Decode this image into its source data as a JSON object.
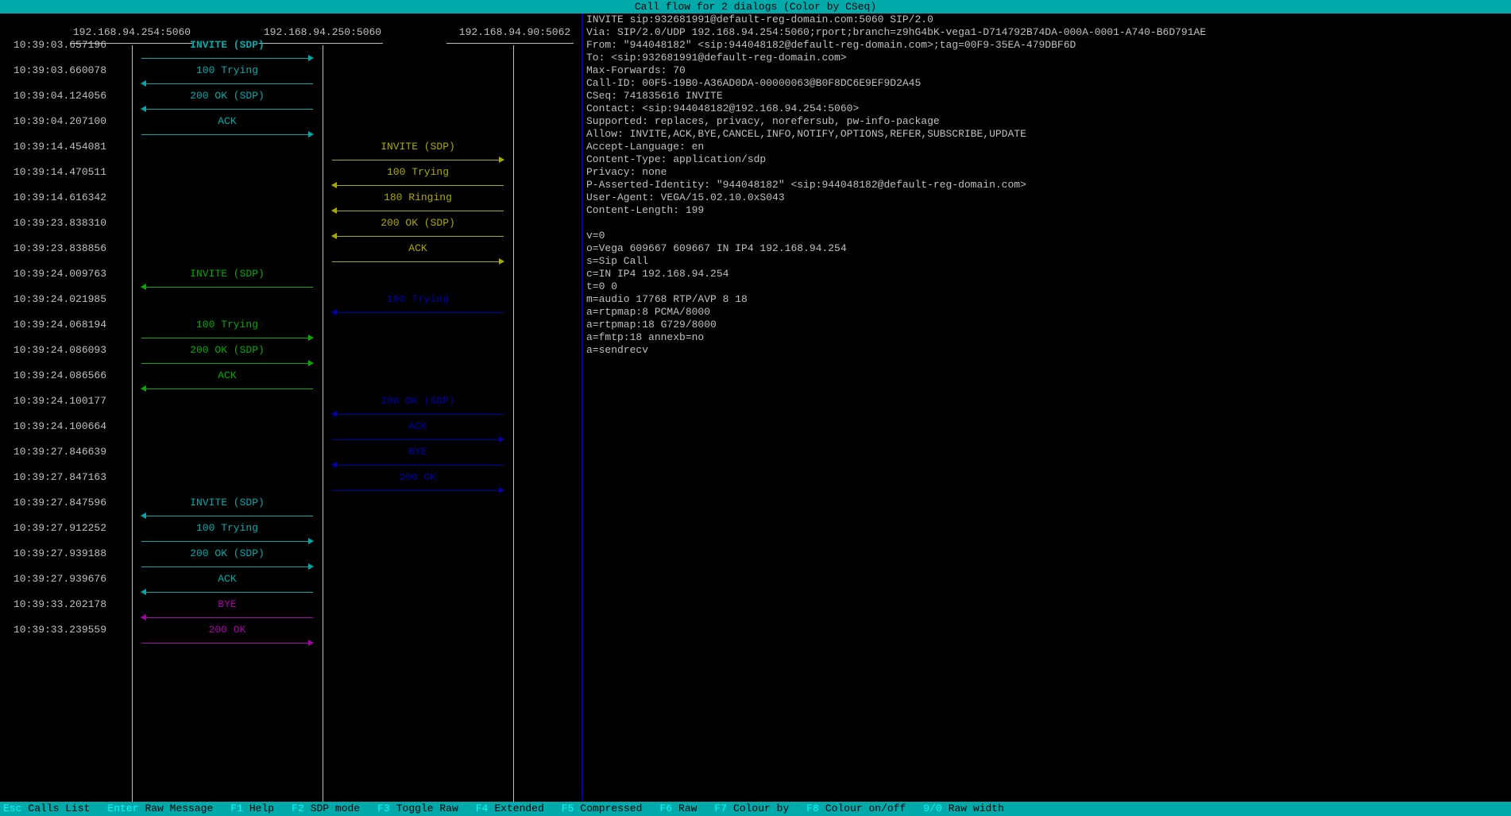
{
  "title": "Call flow for 2 dialogs (Color by CSeq)",
  "hosts": [
    "192.168.94.254:5060",
    "192.168.94.250:5060",
    "192.168.94.90:5062"
  ],
  "colors": {
    "cyan": "#00aaaa",
    "yellow": "#aaaa00",
    "green": "#00aa00",
    "blue": "#0000aa",
    "magenta": "#aa00aa",
    "text": "#c0c0c0",
    "bar": "#00aaaa"
  },
  "messages": [
    {
      "time": "10:39:03.657196",
      "label": "INVITE (SDP)",
      "from": 0,
      "to": 1,
      "color": "cyan",
      "bold": true
    },
    {
      "time": "10:39:03.660078",
      "label": "100 Trying",
      "from": 1,
      "to": 0,
      "color": "cyan"
    },
    {
      "time": "10:39:04.124056",
      "label": "200 OK (SDP)",
      "from": 1,
      "to": 0,
      "color": "cyan"
    },
    {
      "time": "10:39:04.207100",
      "label": "ACK",
      "from": 0,
      "to": 1,
      "color": "cyan"
    },
    {
      "time": "10:39:14.454081",
      "label": "INVITE (SDP)",
      "from": 1,
      "to": 2,
      "color": "yellow"
    },
    {
      "time": "10:39:14.470511",
      "label": "100 Trying",
      "from": 2,
      "to": 1,
      "color": "yellow"
    },
    {
      "time": "10:39:14.616342",
      "label": "180 Ringing",
      "from": 2,
      "to": 1,
      "color": "yellow"
    },
    {
      "time": "10:39:23.838310",
      "label": "200 OK (SDP)",
      "from": 2,
      "to": 1,
      "color": "yellow"
    },
    {
      "time": "10:39:23.838856",
      "label": "ACK",
      "from": 1,
      "to": 2,
      "color": "yellow"
    },
    {
      "time": "10:39:24.009763",
      "label": "INVITE (SDP)",
      "from": 1,
      "to": 0,
      "color": "green"
    },
    {
      "time": "10:39:24.021985",
      "label": "100 Trying",
      "from": 2,
      "to": 1,
      "color": "blue"
    },
    {
      "time": "10:39:24.068194",
      "label": "100 Trying",
      "from": 0,
      "to": 1,
      "color": "green"
    },
    {
      "time": "10:39:24.086093",
      "label": "200 OK (SDP)",
      "from": 0,
      "to": 1,
      "color": "green"
    },
    {
      "time": "10:39:24.086566",
      "label": "ACK",
      "from": 1,
      "to": 0,
      "color": "green"
    },
    {
      "time": "10:39:24.100177",
      "label": "200 OK (SDP)",
      "from": 2,
      "to": 1,
      "color": "blue"
    },
    {
      "time": "10:39:24.100664",
      "label": "ACK",
      "from": 1,
      "to": 2,
      "color": "blue"
    },
    {
      "time": "10:39:27.846639",
      "label": "BYE",
      "from": 2,
      "to": 1,
      "color": "blue"
    },
    {
      "time": "10:39:27.847163",
      "label": "200 OK",
      "from": 1,
      "to": 2,
      "color": "blue"
    },
    {
      "time": "10:39:27.847596",
      "label": "INVITE (SDP)",
      "from": 1,
      "to": 0,
      "color": "cyan"
    },
    {
      "time": "10:39:27.912252",
      "label": "100 Trying",
      "from": 0,
      "to": 1,
      "color": "cyan"
    },
    {
      "time": "10:39:27.939188",
      "label": "200 OK (SDP)",
      "from": 0,
      "to": 1,
      "color": "cyan"
    },
    {
      "time": "10:39:27.939676",
      "label": "ACK",
      "from": 1,
      "to": 0,
      "color": "cyan"
    },
    {
      "time": "10:39:33.202178",
      "label": "BYE",
      "from": 1,
      "to": 0,
      "color": "magenta"
    },
    {
      "time": "10:39:33.239559",
      "label": "200 OK",
      "from": 0,
      "to": 1,
      "color": "magenta"
    }
  ],
  "raw_message": [
    "INVITE sip:932681991@default-reg-domain.com:5060 SIP/2.0",
    "Via: SIP/2.0/UDP 192.168.94.254:5060;rport;branch=z9hG4bK-vega1-D714792B74DA-000A-0001-A740-B6D791AE",
    "From: \"944048182\" <sip:944048182@default-reg-domain.com>;tag=00F9-35EA-479DBF6D",
    "To: <sip:932681991@default-reg-domain.com>",
    "Max-Forwards: 70",
    "Call-ID: 00F5-19B0-A36AD0DA-00000063@B0F8DC6E9EF9D2A45",
    "CSeq: 741835616 INVITE",
    "Contact: <sip:944048182@192.168.94.254:5060>",
    "Supported: replaces, privacy, norefersub, pw-info-package",
    "Allow: INVITE,ACK,BYE,CANCEL,INFO,NOTIFY,OPTIONS,REFER,SUBSCRIBE,UPDATE",
    "Accept-Language: en",
    "Content-Type: application/sdp",
    "Privacy: none",
    "P-Asserted-Identity: \"944048182\" <sip:944048182@default-reg-domain.com>",
    "User-Agent: VEGA/15.02.10.0xS043",
    "Content-Length: 199",
    "",
    "v=0",
    "o=Vega 609667 609667 IN IP4 192.168.94.254",
    "s=Sip Call",
    "c=IN IP4 192.168.94.254",
    "t=0 0",
    "m=audio 17768 RTP/AVP 8 18",
    "a=rtpmap:8 PCMA/8000",
    "a=rtpmap:18 G729/8000",
    "a=fmtp:18 annexb=no",
    "a=sendrecv"
  ],
  "statusbar": [
    {
      "key": "Esc",
      "label": "Calls List"
    },
    {
      "key": "Enter",
      "label": "Raw Message"
    },
    {
      "key": "F1",
      "label": "Help"
    },
    {
      "key": "F2",
      "label": "SDP mode"
    },
    {
      "key": "F3",
      "label": "Toggle Raw"
    },
    {
      "key": "F4",
      "label": "Extended"
    },
    {
      "key": "F5",
      "label": "Compressed"
    },
    {
      "key": "F6",
      "label": "Raw"
    },
    {
      "key": "F7",
      "label": "Colour by"
    },
    {
      "key": "F8",
      "label": "Colour on/off"
    },
    {
      "key": "9/0",
      "label": "Raw width"
    }
  ]
}
